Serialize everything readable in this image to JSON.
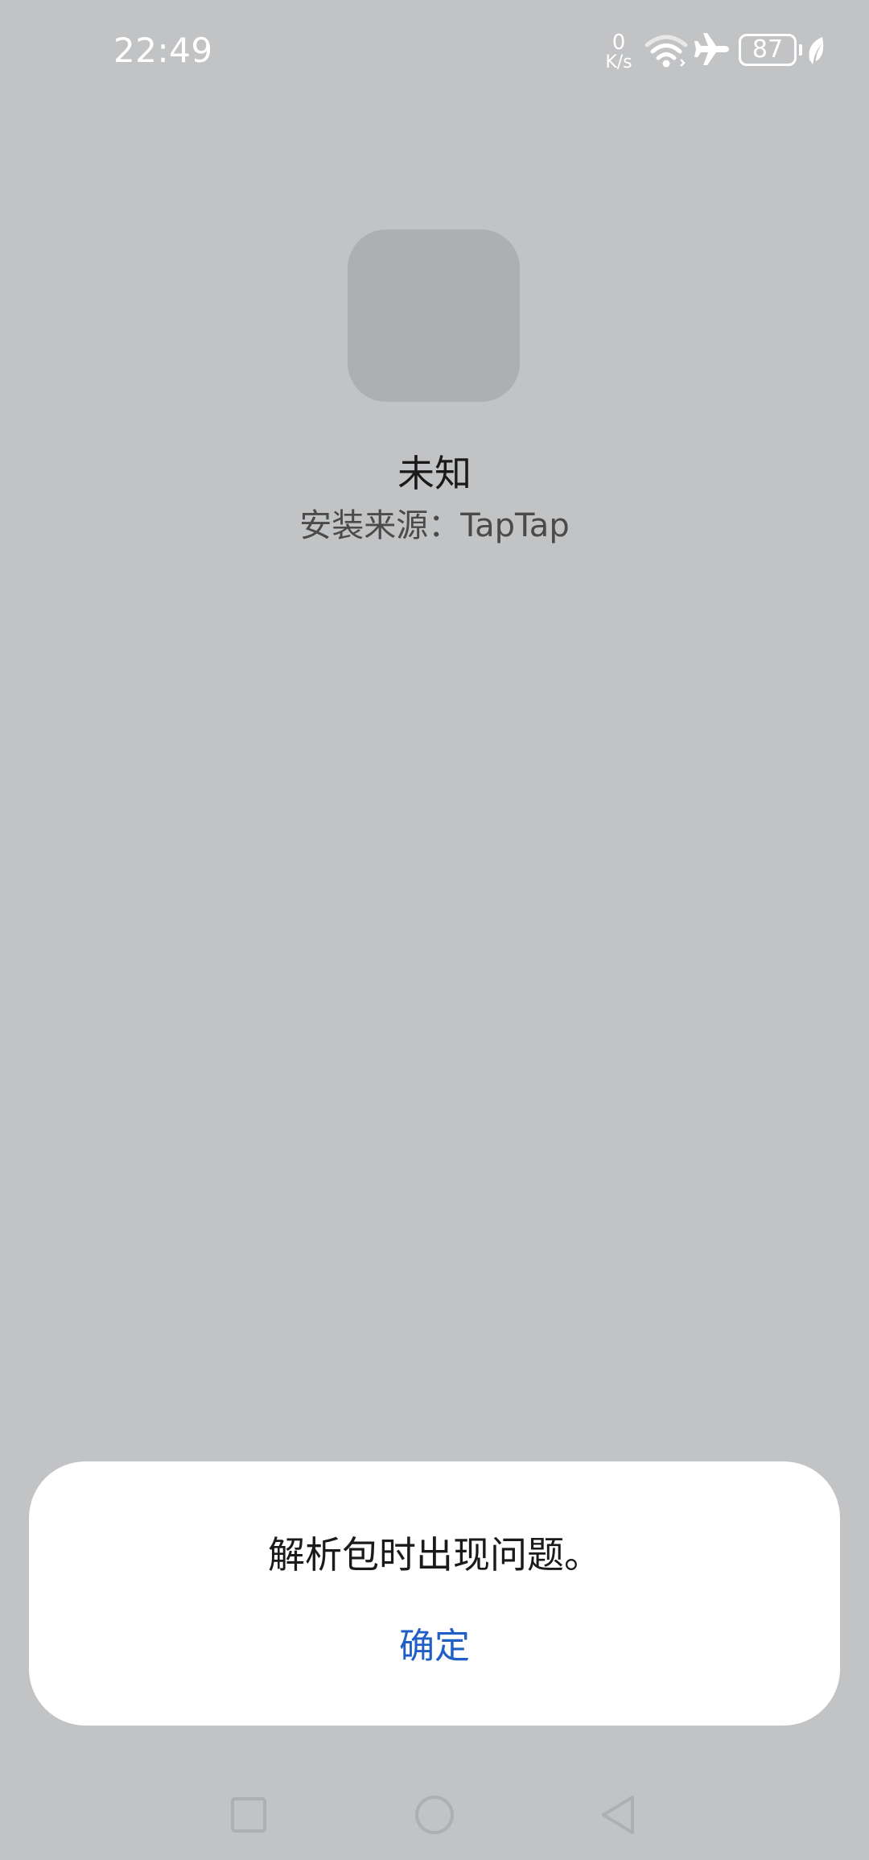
{
  "status_bar": {
    "time": "22:49",
    "net_speed_value": "0",
    "net_speed_unit": "K/s",
    "battery_level": "87",
    "icons": [
      "wifi-icon",
      "airplane-icon",
      "battery-icon",
      "leaf-icon"
    ]
  },
  "app": {
    "name": "未知",
    "install_source": "安装来源：TapTap"
  },
  "dialog": {
    "message": "解析包时出现问题。",
    "confirm_label": "确定"
  },
  "nav_bar": {
    "icons": [
      "recent-apps-icon",
      "home-icon",
      "back-icon"
    ]
  },
  "colors": {
    "background": "#c2c3c5",
    "icon_placeholder": "#aeafb1",
    "dialog_background": "#ffffff",
    "accent": "#1f5fc6",
    "status_icons": "#ffffff",
    "nav_icons": "#aeafb1"
  }
}
